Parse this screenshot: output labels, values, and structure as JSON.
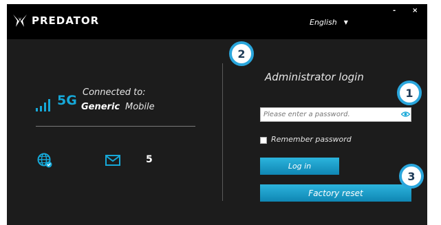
{
  "app": {
    "logo_text": "PREDATOR",
    "language": "English",
    "window_minimize": "-",
    "window_close": "×"
  },
  "status": {
    "network_type": "5G",
    "connected_label": "Connected to:",
    "operator_part1": "Generic",
    "operator_part2": "Mobile",
    "message_count": "5",
    "icons": [
      "signal-bars-icon",
      "globe-icon",
      "mail-icon"
    ]
  },
  "login": {
    "title": "Administrator login",
    "password_placeholder": "Please enter a password.",
    "password_value": "",
    "remember_label": "Remember password",
    "remember_checked": false,
    "login_button": "Log in",
    "reset_button": "Factory reset"
  },
  "annotations": [
    "1",
    "2",
    "3"
  ],
  "colors": {
    "accent": "#16a8d8",
    "background": "#1c1c1c",
    "titlebar": "#000000",
    "badge_border": "#2aa6dc"
  }
}
